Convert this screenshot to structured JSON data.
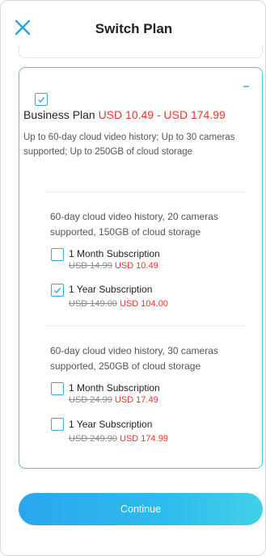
{
  "header": {
    "title": "Switch Plan",
    "close_icon": "close-icon"
  },
  "colors": {
    "accent": "#3aa8dc",
    "price_red": "#f0352a",
    "card_border": "#4fc3ea"
  },
  "plan": {
    "checked": true,
    "name": "Business Plan",
    "price_range": "USD 10.49 - USD 174.99",
    "description": "Up to 60-day cloud video history; Up to 30 cameras supported; Up to 250GB of cloud storage",
    "tiers": [
      {
        "description": "60-day cloud video history, 20 cameras supported, 150GB of cloud storage",
        "options": [
          {
            "label": "1 Month Subscription",
            "old_price": "USD 14.99",
            "new_price": "USD 10.49",
            "checked": false
          },
          {
            "label": "1 Year Subscription",
            "old_price": "USD 149.00",
            "new_price": "USD 104.00",
            "checked": true
          }
        ]
      },
      {
        "description": "60-day cloud video history, 30 cameras supported, 250GB of cloud storage",
        "options": [
          {
            "label": "1 Month Subscription",
            "old_price": "USD 24.99",
            "new_price": "USD 17.49",
            "checked": false
          },
          {
            "label": "1 Year Subscription",
            "old_price": "USD 249.90",
            "new_price": "USD 174.99",
            "checked": false
          }
        ]
      }
    ]
  },
  "footer": {
    "continue_label": "Continue"
  }
}
